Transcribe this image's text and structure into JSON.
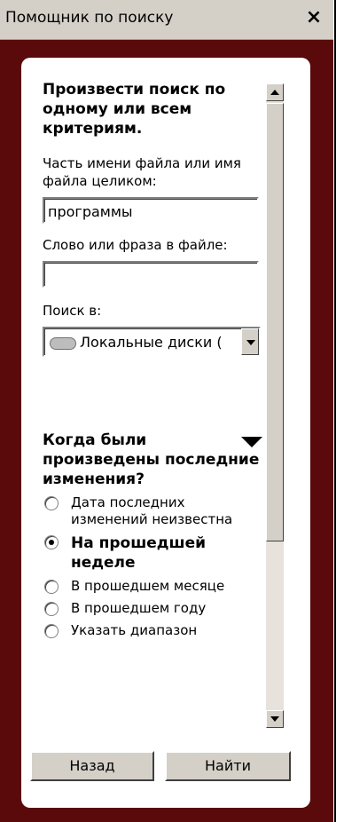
{
  "titlebar": {
    "title": "Помощник по поиску",
    "close": "×"
  },
  "panel": {
    "heading": "Произвести поиск по одному или всем критериям.",
    "filename_label": "Часть имени файла или имя файла целиком:",
    "filename_value": "программы",
    "phrase_label": "Слово или фраза в файле:",
    "phrase_value": "",
    "lookin_label": "Поиск в:",
    "lookin_value": "Локальные диски (",
    "modified": {
      "heading": "Когда были произведены последние изменения?",
      "options": [
        {
          "label": "Дата последних изменений неизвестна",
          "selected": false
        },
        {
          "label": "На прошедшей неделе",
          "selected": true
        },
        {
          "label": "В прошедшем месяце",
          "selected": false
        },
        {
          "label": "В прошедшем году",
          "selected": false
        },
        {
          "label": "Указать диапазон",
          "selected": false
        }
      ]
    }
  },
  "buttons": {
    "back": "Назад",
    "search": "Найти"
  },
  "colors": {
    "frame": "#5a0a0a",
    "chrome": "#d4d0c8",
    "panel": "#ffffff"
  },
  "icons": {
    "close": "close-icon",
    "drive": "drive-icon",
    "collapse": "collapse-triangle-icon"
  }
}
